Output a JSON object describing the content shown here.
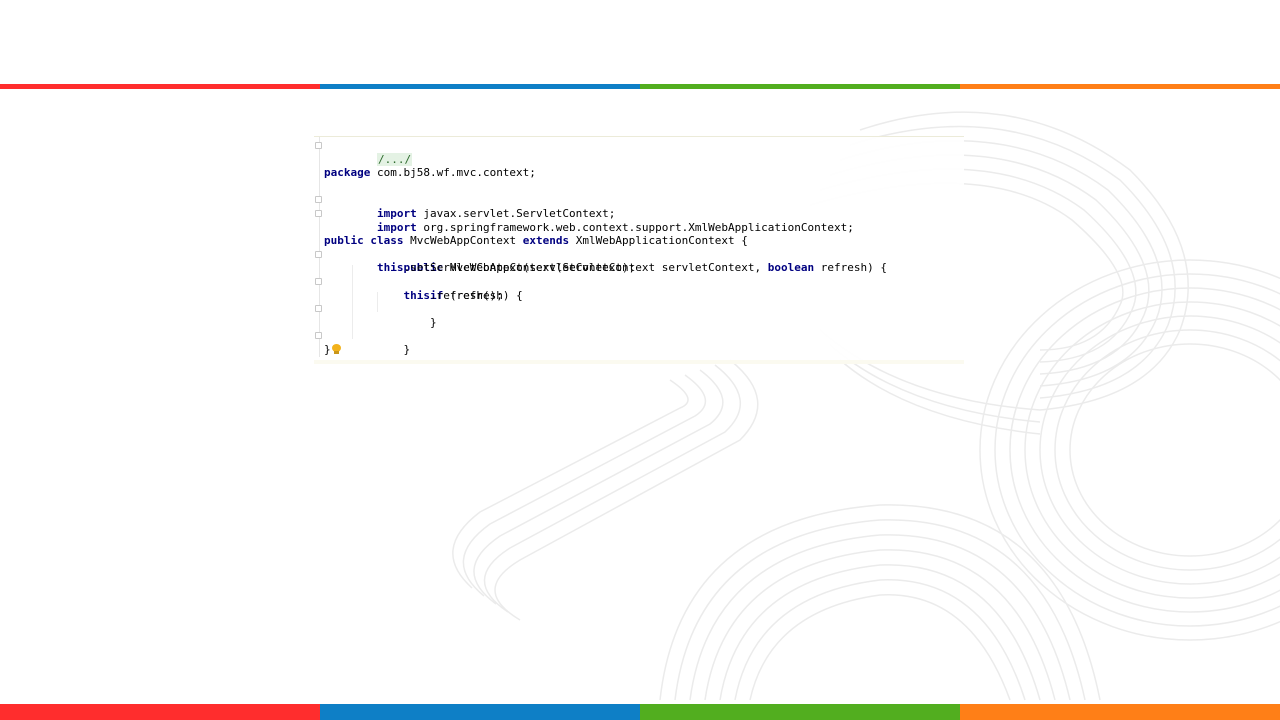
{
  "colors": {
    "stripe": [
      "#ff2d2d",
      "#0e7fc6",
      "#52ae1f",
      "#ff7f17"
    ],
    "keyword": "#000080",
    "folded_region_bg": "#e4f2e4",
    "background_art": "#e8e8e8"
  },
  "editor": {
    "folded_header": "/.../",
    "package_keyword": "package",
    "package_name": " com.bj58.wf.mvc.context;",
    "imports": [
      {
        "keyword": "import",
        "path": " javax.servlet.ServletContext;"
      },
      {
        "keyword": "import",
        "path": " org.springframework.web.context.support.XmlWebApplicationContext;"
      }
    ],
    "class_decl": {
      "public_kw": "public",
      "class_kw": "class",
      "name": " MvcWebAppContext ",
      "extends_kw": "extends",
      "super": " XmlWebApplicationContext {"
    },
    "ctor_decl": {
      "indent": "    ",
      "public_kw": "public",
      "signature": " MvcWebAppContext(ServletContext servletContext, ",
      "boolean_kw": "boolean",
      "rest": " refresh) {"
    },
    "stmt1": {
      "indent": "        ",
      "this_kw": "this",
      "rest": ".setServletContext(servletContext);"
    },
    "if_stmt": {
      "indent": "        ",
      "if_kw": "if",
      "rest": " (refresh) {"
    },
    "stmt2": {
      "indent": "            ",
      "this_kw": "this",
      "rest": ".refresh();"
    },
    "close_if": "        }",
    "close_ctor": "    }",
    "close_class": "}",
    "intention_icon": "lightbulb-icon"
  }
}
